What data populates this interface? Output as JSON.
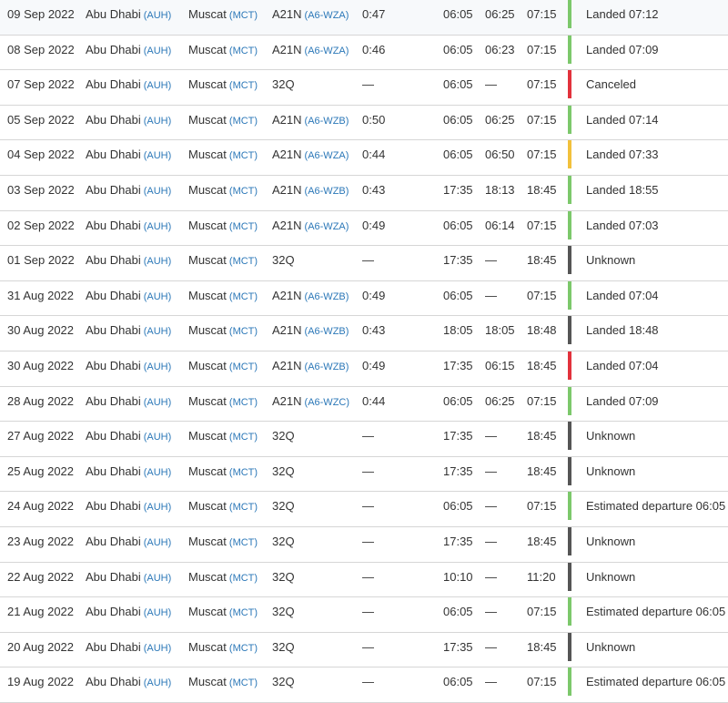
{
  "colors": {
    "landed": "#7cc86b",
    "canceled": "#e2323c",
    "delayed": "#f2c13c",
    "unknown": "#555555",
    "estimated": "#7cc86b",
    "link": "#2c78b8"
  },
  "flights": [
    {
      "date": "09 Sep 2022",
      "from": "Abu Dhabi",
      "from_code": "(AUH)",
      "to": "Muscat",
      "to_code": "(MCT)",
      "aircraft": "A21N",
      "reg": "(A6-WZA)",
      "duration": "0:47",
      "std": "06:05",
      "atd": "06:25",
      "sta": "07:15",
      "status": "Landed 07:12",
      "status_color": "landed"
    },
    {
      "date": "08 Sep 2022",
      "from": "Abu Dhabi",
      "from_code": "(AUH)",
      "to": "Muscat",
      "to_code": "(MCT)",
      "aircraft": "A21N",
      "reg": "(A6-WZA)",
      "duration": "0:46",
      "std": "06:05",
      "atd": "06:23",
      "sta": "07:15",
      "status": "Landed 07:09",
      "status_color": "landed"
    },
    {
      "date": "07 Sep 2022",
      "from": "Abu Dhabi",
      "from_code": "(AUH)",
      "to": "Muscat",
      "to_code": "(MCT)",
      "aircraft": "32Q",
      "reg": "",
      "duration": "—",
      "std": "06:05",
      "atd": "—",
      "sta": "07:15",
      "status": "Canceled",
      "status_color": "canceled"
    },
    {
      "date": "05 Sep 2022",
      "from": "Abu Dhabi",
      "from_code": "(AUH)",
      "to": "Muscat",
      "to_code": "(MCT)",
      "aircraft": "A21N",
      "reg": "(A6-WZB)",
      "duration": "0:50",
      "std": "06:05",
      "atd": "06:25",
      "sta": "07:15",
      "status": "Landed 07:14",
      "status_color": "landed"
    },
    {
      "date": "04 Sep 2022",
      "from": "Abu Dhabi",
      "from_code": "(AUH)",
      "to": "Muscat",
      "to_code": "(MCT)",
      "aircraft": "A21N",
      "reg": "(A6-WZA)",
      "duration": "0:44",
      "std": "06:05",
      "atd": "06:50",
      "sta": "07:15",
      "status": "Landed 07:33",
      "status_color": "delayed"
    },
    {
      "date": "03 Sep 2022",
      "from": "Abu Dhabi",
      "from_code": "(AUH)",
      "to": "Muscat",
      "to_code": "(MCT)",
      "aircraft": "A21N",
      "reg": "(A6-WZB)",
      "duration": "0:43",
      "std": "17:35",
      "atd": "18:13",
      "sta": "18:45",
      "status": "Landed 18:55",
      "status_color": "landed"
    },
    {
      "date": "02 Sep 2022",
      "from": "Abu Dhabi",
      "from_code": "(AUH)",
      "to": "Muscat",
      "to_code": "(MCT)",
      "aircraft": "A21N",
      "reg": "(A6-WZA)",
      "duration": "0:49",
      "std": "06:05",
      "atd": "06:14",
      "sta": "07:15",
      "status": "Landed 07:03",
      "status_color": "landed"
    },
    {
      "date": "01 Sep 2022",
      "from": "Abu Dhabi",
      "from_code": "(AUH)",
      "to": "Muscat",
      "to_code": "(MCT)",
      "aircraft": "32Q",
      "reg": "",
      "duration": "—",
      "std": "17:35",
      "atd": "—",
      "sta": "18:45",
      "status": "Unknown",
      "status_color": "unknown"
    },
    {
      "date": "31 Aug 2022",
      "from": "Abu Dhabi",
      "from_code": "(AUH)",
      "to": "Muscat",
      "to_code": "(MCT)",
      "aircraft": "A21N",
      "reg": "(A6-WZB)",
      "duration": "0:49",
      "std": "06:05",
      "atd": "—",
      "sta": "07:15",
      "status": "Landed 07:04",
      "status_color": "landed"
    },
    {
      "date": "30 Aug 2022",
      "from": "Abu Dhabi",
      "from_code": "(AUH)",
      "to": "Muscat",
      "to_code": "(MCT)",
      "aircraft": "A21N",
      "reg": "(A6-WZB)",
      "duration": "0:43",
      "std": "18:05",
      "atd": "18:05",
      "sta": "18:48",
      "status": "Landed 18:48",
      "status_color": "unknown"
    },
    {
      "date": "30 Aug 2022",
      "from": "Abu Dhabi",
      "from_code": "(AUH)",
      "to": "Muscat",
      "to_code": "(MCT)",
      "aircraft": "A21N",
      "reg": "(A6-WZB)",
      "duration": "0:49",
      "std": "17:35",
      "atd": "06:15",
      "sta": "18:45",
      "status": "Landed 07:04",
      "status_color": "canceled"
    },
    {
      "date": "28 Aug 2022",
      "from": "Abu Dhabi",
      "from_code": "(AUH)",
      "to": "Muscat",
      "to_code": "(MCT)",
      "aircraft": "A21N",
      "reg": "(A6-WZC)",
      "duration": "0:44",
      "std": "06:05",
      "atd": "06:25",
      "sta": "07:15",
      "status": "Landed 07:09",
      "status_color": "landed"
    },
    {
      "date": "27 Aug 2022",
      "from": "Abu Dhabi",
      "from_code": "(AUH)",
      "to": "Muscat",
      "to_code": "(MCT)",
      "aircraft": "32Q",
      "reg": "",
      "duration": "—",
      "std": "17:35",
      "atd": "—",
      "sta": "18:45",
      "status": "Unknown",
      "status_color": "unknown"
    },
    {
      "date": "25 Aug 2022",
      "from": "Abu Dhabi",
      "from_code": "(AUH)",
      "to": "Muscat",
      "to_code": "(MCT)",
      "aircraft": "32Q",
      "reg": "",
      "duration": "—",
      "std": "17:35",
      "atd": "—",
      "sta": "18:45",
      "status": "Unknown",
      "status_color": "unknown"
    },
    {
      "date": "24 Aug 2022",
      "from": "Abu Dhabi",
      "from_code": "(AUH)",
      "to": "Muscat",
      "to_code": "(MCT)",
      "aircraft": "32Q",
      "reg": "",
      "duration": "—",
      "std": "06:05",
      "atd": "—",
      "sta": "07:15",
      "status": "Estimated departure 06:05",
      "status_color": "estimated"
    },
    {
      "date": "23 Aug 2022",
      "from": "Abu Dhabi",
      "from_code": "(AUH)",
      "to": "Muscat",
      "to_code": "(MCT)",
      "aircraft": "32Q",
      "reg": "",
      "duration": "—",
      "std": "17:35",
      "atd": "—",
      "sta": "18:45",
      "status": "Unknown",
      "status_color": "unknown"
    },
    {
      "date": "22 Aug 2022",
      "from": "Abu Dhabi",
      "from_code": "(AUH)",
      "to": "Muscat",
      "to_code": "(MCT)",
      "aircraft": "32Q",
      "reg": "",
      "duration": "—",
      "std": "10:10",
      "atd": "—",
      "sta": "11:20",
      "status": "Unknown",
      "status_color": "unknown"
    },
    {
      "date": "21 Aug 2022",
      "from": "Abu Dhabi",
      "from_code": "(AUH)",
      "to": "Muscat",
      "to_code": "(MCT)",
      "aircraft": "32Q",
      "reg": "",
      "duration": "—",
      "std": "06:05",
      "atd": "—",
      "sta": "07:15",
      "status": "Estimated departure 06:05",
      "status_color": "estimated"
    },
    {
      "date": "20 Aug 2022",
      "from": "Abu Dhabi",
      "from_code": "(AUH)",
      "to": "Muscat",
      "to_code": "(MCT)",
      "aircraft": "32Q",
      "reg": "",
      "duration": "—",
      "std": "17:35",
      "atd": "—",
      "sta": "18:45",
      "status": "Unknown",
      "status_color": "unknown"
    },
    {
      "date": "19 Aug 2022",
      "from": "Abu Dhabi",
      "from_code": "(AUH)",
      "to": "Muscat",
      "to_code": "(MCT)",
      "aircraft": "32Q",
      "reg": "",
      "duration": "—",
      "std": "06:05",
      "atd": "—",
      "sta": "07:15",
      "status": "Estimated departure 06:05",
      "status_color": "estimated"
    }
  ]
}
